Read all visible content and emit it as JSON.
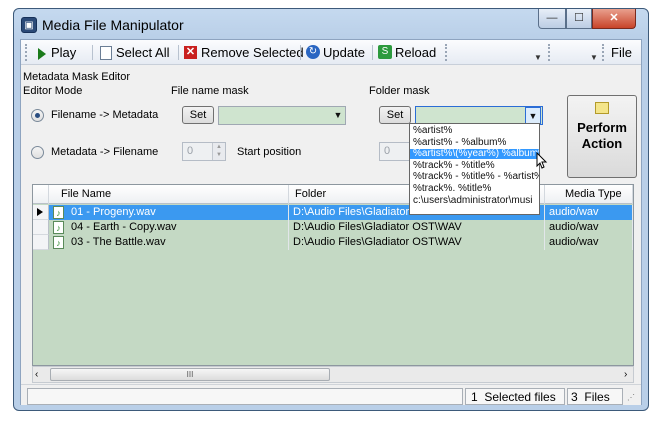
{
  "window": {
    "title": "Media File Manipulator",
    "icon": "app-icon"
  },
  "caption_buttons": {
    "minimize": "—",
    "maximize": "☐",
    "close": "✕"
  },
  "toolbar": {
    "play": "Play",
    "select_all": "Select All",
    "remove_selected": "Remove Selected",
    "update": "Update",
    "reload": "Reload",
    "file": "File"
  },
  "editor": {
    "title": "Metadata Mask Editor",
    "mode_group": "Editor Mode",
    "mode_options": [
      "Filename -> Metadata",
      "Metadata -> Filename"
    ],
    "mode_selected": 0,
    "filename_mask_label": "File name mask",
    "folder_mask_label": "Folder mask",
    "set_label": "Set",
    "start_spin_value": "0",
    "start_position_label": "Start position",
    "folder_spin_value": "0",
    "perform_line1": "Perform",
    "perform_line2": "Action"
  },
  "folder_mask_options": [
    "%artist%",
    "%artist% - %album%",
    "%artist%\\(%year%) %album%",
    "%track% - %title%",
    "%track% - %title% - %artist%",
    "%track%. %title%",
    "c:\\users\\administrator\\musi"
  ],
  "folder_mask_highlighted": 2,
  "table": {
    "columns": [
      "File Name",
      "Folder",
      "Media Type"
    ],
    "rows": [
      {
        "file": "01 - Progeny.wav",
        "folder": "D:\\Audio Files\\Gladiator",
        "type": "audio/wav",
        "selected": true
      },
      {
        "file": "04 - Earth - Copy.wav",
        "folder": "D:\\Audio Files\\Gladiator OST\\WAV",
        "type": "audio/wav",
        "selected": false
      },
      {
        "file": "03 - The Battle.wav",
        "folder": "D:\\Audio Files\\Gladiator OST\\WAV",
        "type": "audio/wav",
        "selected": false
      }
    ]
  },
  "scrollbar": {
    "left": "‹",
    "right": "›",
    "grip": "III"
  },
  "status": {
    "selected_count": "1",
    "selected_label": "Selected files",
    "file_count": "3",
    "files_label": "Files"
  },
  "colors": {
    "selection": "#3b99f0",
    "grid_bg": "#c4d9c4",
    "combo_bg": "#cfe4cf"
  }
}
